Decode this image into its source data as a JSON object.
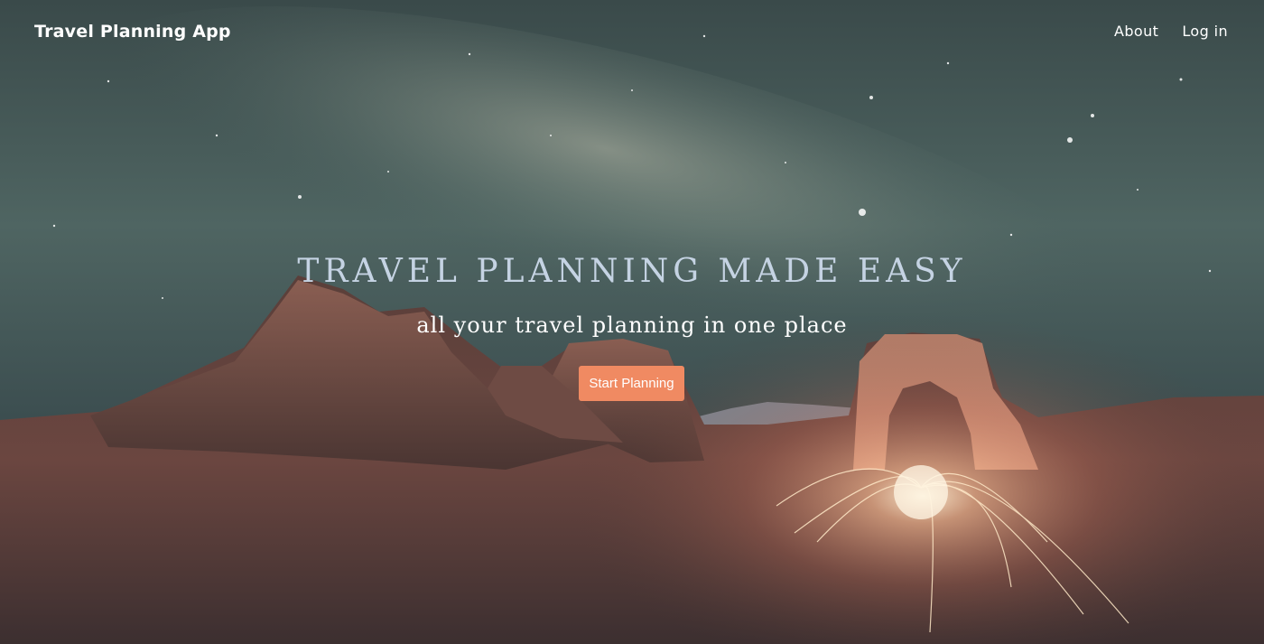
{
  "header": {
    "app_title": "Travel Planning App",
    "nav": [
      {
        "label": "About"
      },
      {
        "label": "Log in"
      }
    ]
  },
  "hero": {
    "headline": "TRAVEL PLANNING MADE EASY",
    "tagline": "all your travel planning in one place",
    "cta_label": "Start Planning",
    "cta_color": "#f08a62",
    "background": "night sky with milky way over desert arch with spinning sparks"
  }
}
